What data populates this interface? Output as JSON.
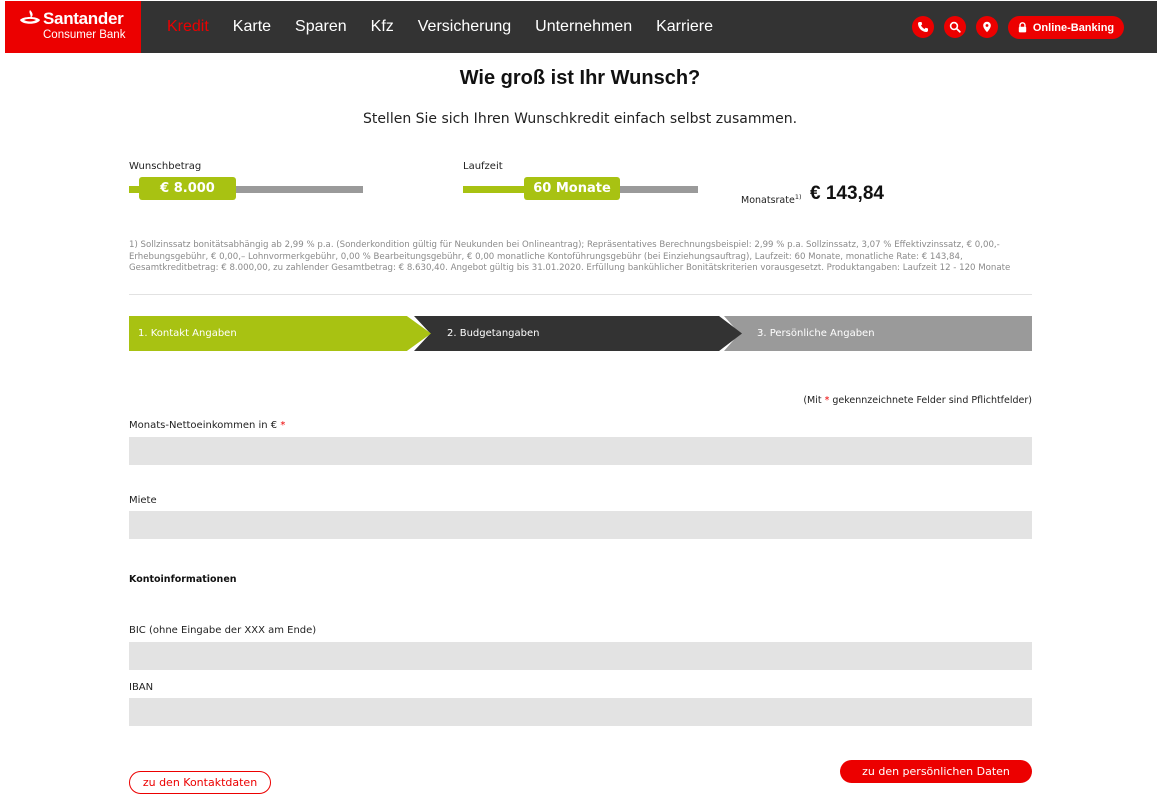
{
  "brand": {
    "name": "Santander",
    "sub": "Consumer Bank",
    "color": "#ec0000"
  },
  "nav": [
    {
      "label": "Kredit",
      "active": true
    },
    {
      "label": "Karte"
    },
    {
      "label": "Sparen"
    },
    {
      "label": "Kfz"
    },
    {
      "label": "Versicherung"
    },
    {
      "label": "Unternehmen"
    },
    {
      "label": "Karriere"
    }
  ],
  "header_icons": [
    "phone-icon",
    "search-icon",
    "location-pin-icon",
    "lock-icon"
  ],
  "online_banking": "Online-Banking",
  "title": "Wie groß ist Ihr Wunsch?",
  "subtitle": "Stellen Sie sich Ihren Wunschkredit einfach selbst zusammen.",
  "calculator": {
    "amount_label": "Wunschbetrag",
    "amount_value": "€ 8.000",
    "amount_fraction": 0.05,
    "term_label": "Laufzeit",
    "term_value": "60 Monate",
    "term_fraction": 0.45,
    "rate_label": "Monatsrate",
    "rate_sup": "1)",
    "rate_value": "€ 143,84",
    "accent": "#a8c212"
  },
  "footnote": "1) Sollzinssatz bonitätsabhängig ab 2,99 % p.a. (Sonderkondition gültig für Neukunden bei Onlineantrag); Repräsentatives Berechnungsbeispiel: 2,99 % p.a. Sollzinssatz, 3,07 % Effektivzinssatz, € 0,00,- Erhebungsgebühr, € 0,00,– Lohnvormerkgebühr, 0,00 % Bearbeitungsgebühr, € 0,00 monatliche Kontoführungsgebühr (bei Einziehungsauftrag), Laufzeit: 60 Monate, monatliche Rate: € 143,84, Gesamtkreditbetrag: € 8.000,00, zu zahlender Gesamtbetrag: € 8.630,40. Angebot gültig bis 31.01.2020. Erfüllung bankühlicher Bonitätskriterien vorausgesetzt. Produktangaben: Laufzeit 12 - 120 Monate",
  "steps": [
    {
      "label": "1. Kontakt Angaben",
      "state": "done"
    },
    {
      "label": "2. Budgetangaben",
      "state": "active"
    },
    {
      "label": "3. Persönliche Angaben",
      "state": "todo"
    }
  ],
  "required_note": {
    "pre": "(Mit ",
    "star": "*",
    "post": " gekennzeichnete Felder sind Pflichtfelder)"
  },
  "form": {
    "income_label": "Monats-Nettoeinkommen in €",
    "income_value": "",
    "rent_label": "Miete",
    "rent_value": "",
    "account_section": "Kontoinformationen",
    "bic_label": "BIC (ohne Eingabe der XXX am Ende)",
    "bic_value": "",
    "iban_label": "IBAN",
    "iban_value": ""
  },
  "buttons": {
    "back": "zu den Kontaktdaten",
    "next": "zu den persönlichen Daten"
  }
}
